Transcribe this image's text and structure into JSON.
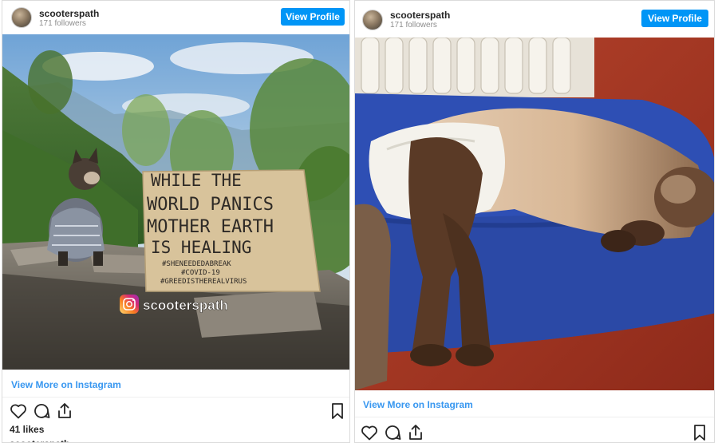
{
  "left_post": {
    "username": "scooterspath",
    "followers": "171 followers",
    "view_profile_label": "View Profile",
    "sign_lines": [
      "WHILE THE",
      "WORLD PANICS",
      "MOTHER EARTH",
      "IS HEALING"
    ],
    "hashtags": [
      "#SHENEEDEDABREAK",
      "#COVID-19",
      "#GREEDISTHEREALVIRUS"
    ],
    "watermark": "scooterspath",
    "view_more_label": "View More on Instagram",
    "likes": "41 likes",
    "caption_username": "scooterspath"
  },
  "right_post": {
    "username": "scooterspath",
    "followers": "171 followers",
    "view_profile_label": "View Profile",
    "view_more_label": "View More on Instagram"
  },
  "colors": {
    "accent_button": "#0095f6",
    "link": "#3897f0",
    "border": "#dbdbdb"
  },
  "icons": [
    "heart-icon",
    "comment-icon",
    "share-icon",
    "bookmark-icon"
  ]
}
